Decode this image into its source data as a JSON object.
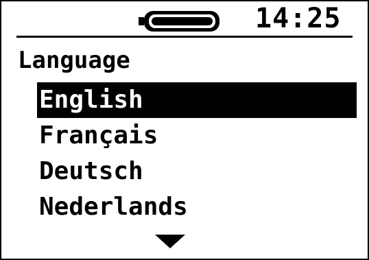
{
  "status": {
    "battery_icon": "battery-full-icon",
    "time": "14:25"
  },
  "menu": {
    "title": "Language",
    "items": [
      {
        "label": "English",
        "selected": true
      },
      {
        "label": "Français",
        "selected": false
      },
      {
        "label": "Deutsch",
        "selected": false
      },
      {
        "label": "Nederlands",
        "selected": false
      }
    ],
    "more_indicator": "chevron-down-icon"
  }
}
